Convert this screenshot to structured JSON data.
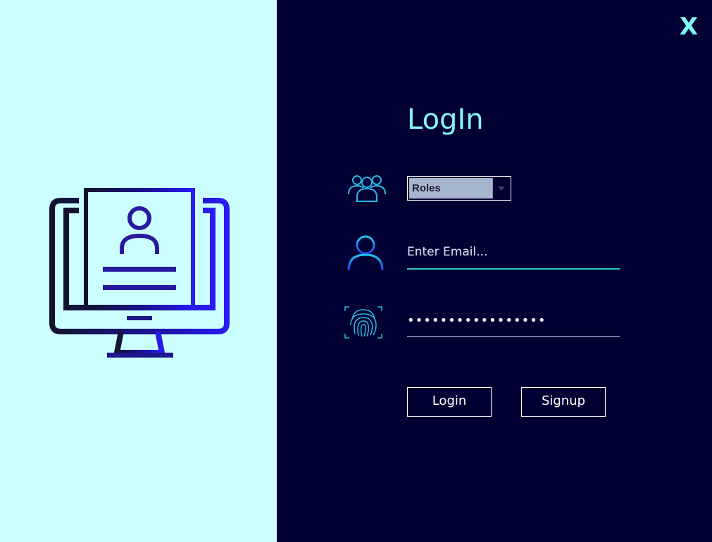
{
  "window": {
    "close_label": "X"
  },
  "form": {
    "title": "LogIn",
    "roles": {
      "selected": "Roles"
    },
    "email": {
      "value": "",
      "placeholder": "Enter Email..."
    },
    "password": {
      "value": "•••••••••••••••••"
    },
    "buttons": {
      "login": "Login",
      "signup": "Signup"
    }
  },
  "icons": {
    "illustration": "computer-user-profile-icon",
    "roles": "users-group-icon",
    "email": "user-icon",
    "password": "fingerprint-icon"
  },
  "colors": {
    "left_background": "#ccffff",
    "right_background": "#000032",
    "accent": "#86f3f7",
    "input_underline": "#2ec6d6"
  }
}
